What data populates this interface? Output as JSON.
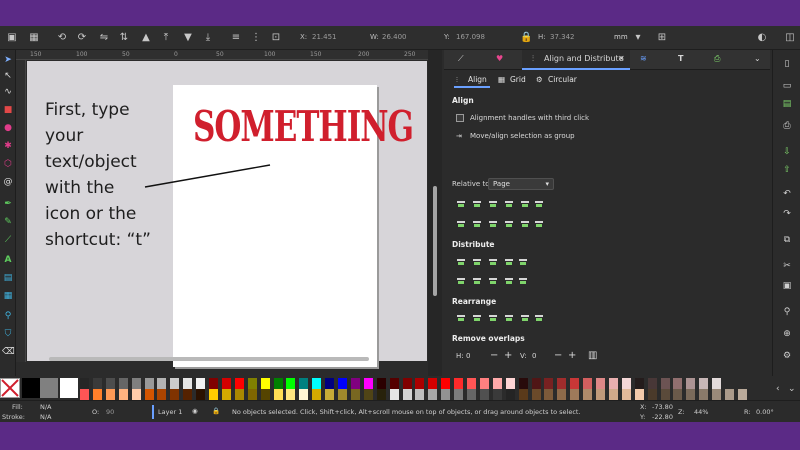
{
  "toolbar": {
    "x_label": "X:",
    "x_value": "21.451",
    "w_label": "W:",
    "w_value": "26.400",
    "y_label": "Y:",
    "y_value": "167.098",
    "h_label": "H:",
    "h_value": "37.342",
    "unit": "mm"
  },
  "ruler": {
    "ticks": [
      "150",
      "100",
      "50",
      "0",
      "50",
      "100",
      "150",
      "200",
      "250"
    ]
  },
  "canvas": {
    "artwork_text": "SOMETHING",
    "instruction_lines": [
      "First, type",
      "your",
      "text/object",
      "with the",
      "icon or the",
      "shortcut: “t”"
    ]
  },
  "panel": {
    "tabs": {
      "active": "Align and Distribute"
    },
    "subtabs": {
      "align": "Align",
      "grid": "Grid",
      "circular": "Circular"
    },
    "align_section": "Align",
    "option_third_click": "Alignment handles with third click",
    "option_move_group": "Move/align selection as group",
    "relative_to_label": "Relative to:",
    "relative_to_value": "Page",
    "distribute_section": "Distribute",
    "rearrange_section": "Rearrange",
    "remove_overlaps_section": "Remove overlaps",
    "h_label": "H:",
    "h_value": "0",
    "v_label": "V:",
    "v_value": "0",
    "minus": "−",
    "plus": "+"
  },
  "status": {
    "fill_label": "Fill:",
    "fill_value": "N/A",
    "stroke_label": "Stroke:",
    "stroke_value": "N/A",
    "opacity_label": "O:",
    "opacity_value": "90",
    "layer": "Layer 1",
    "message": "No objects selected. Click, Shift+click, Alt+scroll mouse on top of objects, or drag around objects to select.",
    "x_label": "X:",
    "x_value": "-73.80",
    "y_label": "Y:",
    "y_value": "-22.80",
    "z_label": "Z:",
    "zoom": "44%",
    "r_label": "R:",
    "rotation": "0.00°"
  },
  "colors": {
    "accent": "#6aa0ff",
    "frame": "#5b2a86",
    "artwork_red": "#d01f2d"
  }
}
